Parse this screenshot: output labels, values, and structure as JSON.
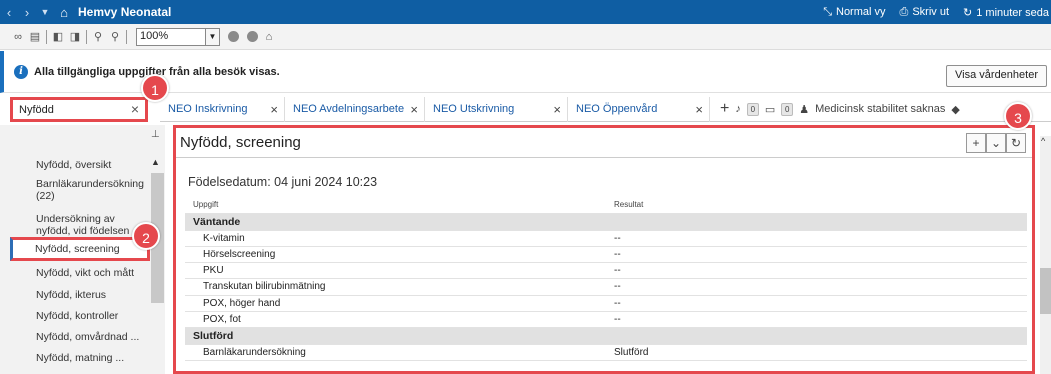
{
  "titlebar": {
    "title": "Hemvy Neonatal",
    "back_icon": "back-arrow-icon",
    "forward_icon": "forward-arrow-icon",
    "home_icon": "home-icon",
    "normal_view": "Normal vy",
    "print": "Skriv ut",
    "refresh": "1 minuter seda"
  },
  "toolbar": {
    "zoom": "100%"
  },
  "banner": {
    "message": "Alla tillgängliga uppgifter från alla besök visas.",
    "button": "Visa vårdenheter"
  },
  "search": {
    "value": "Nyfödd"
  },
  "tabs": [
    {
      "label": "NEO Inskrivning"
    },
    {
      "label": "NEO Avdelningsarbete"
    },
    {
      "label": "NEO Utskrivning"
    },
    {
      "label": "NEO Öppenvård"
    }
  ],
  "tab_extras": {
    "bell_count": "0",
    "inbox_count": "0",
    "status": "Medicinsk stabilitet saknas"
  },
  "sidebar": {
    "items": [
      {
        "label": "Nyfödd, översikt"
      },
      {
        "label": "Barnläkarundersökning (22)"
      },
      {
        "label": "Undersökning av nyfödd, vid födelsen"
      },
      {
        "label": "Nyfödd, screening"
      },
      {
        "label": "Nyfödd, vikt och mått"
      },
      {
        "label": "Nyfödd, ikterus"
      },
      {
        "label": "Nyfödd, kontroller"
      },
      {
        "label": "Nyfödd, omvårdnad ..."
      },
      {
        "label": "Nyfödd, matning ..."
      }
    ]
  },
  "panel": {
    "title": "Nyfödd, screening",
    "dob_label": "Födelsedatum: 04 juni 2024 10:23",
    "col_task": "Uppgift",
    "col_result": "Resultat",
    "groups": [
      {
        "name": "Väntande",
        "rows": [
          {
            "task": "K-vitamin",
            "result": "--"
          },
          {
            "task": "Hörselscreening",
            "result": "--"
          },
          {
            "task": "PKU",
            "result": "--"
          },
          {
            "task": "Transkutan bilirubinmätning",
            "result": "--"
          },
          {
            "task": "POX, höger hand",
            "result": "--"
          },
          {
            "task": "POX, fot",
            "result": "--"
          }
        ]
      },
      {
        "name": "Slutförd",
        "rows": [
          {
            "task": "Barnläkarundersökning",
            "result": "Slutförd"
          }
        ]
      }
    ]
  },
  "callouts": {
    "c1": "1",
    "c2": "2",
    "c3": "3"
  }
}
